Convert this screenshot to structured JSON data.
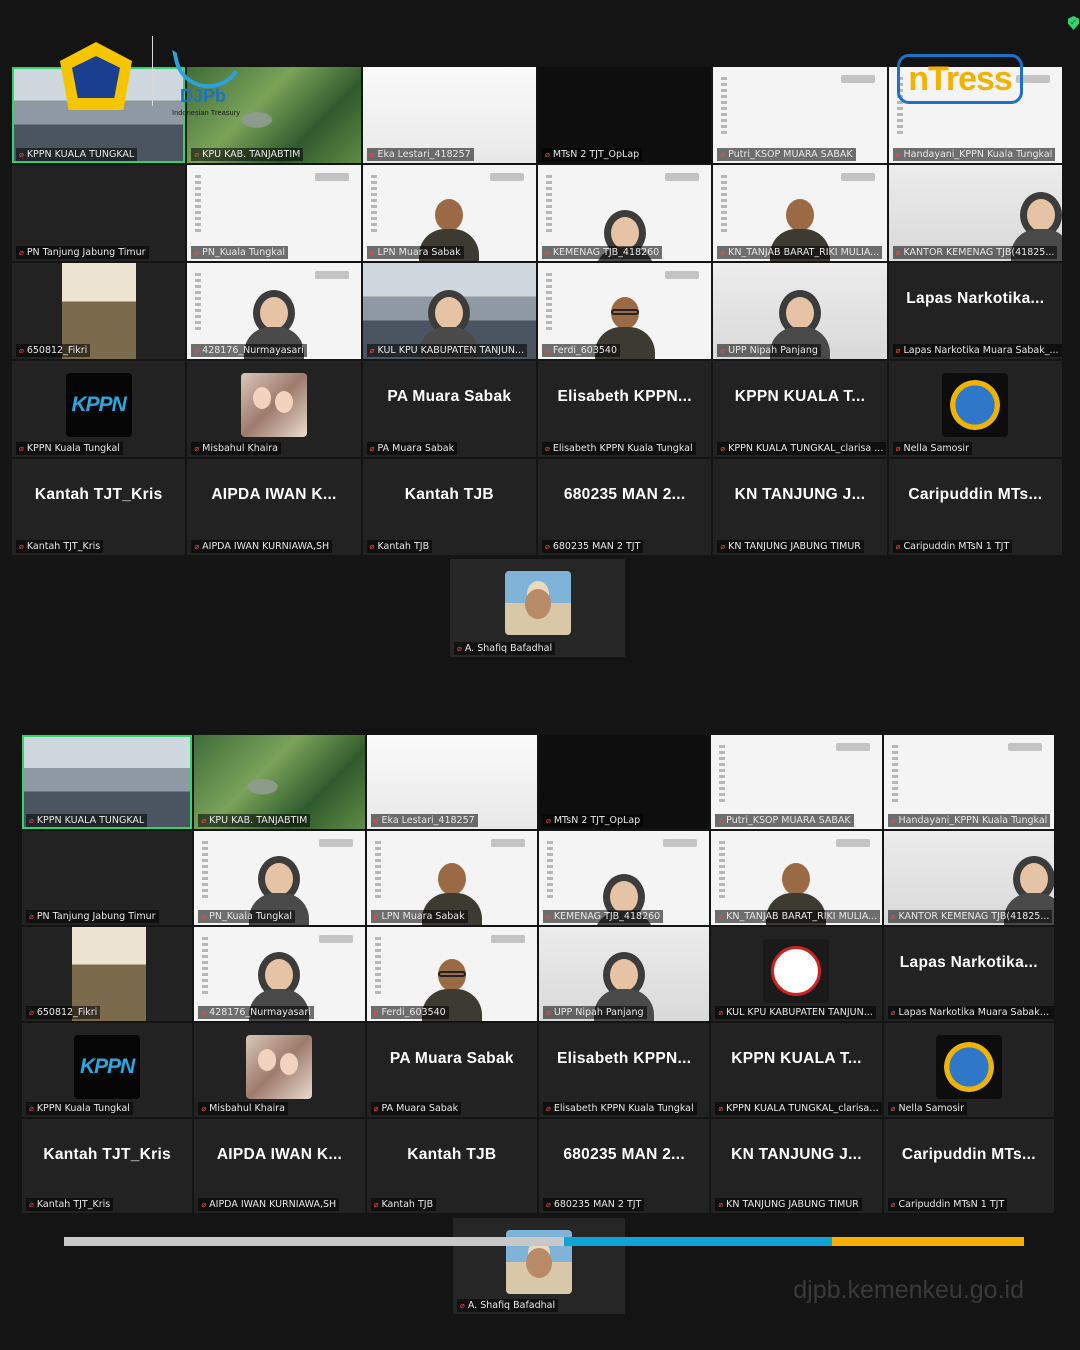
{
  "branding": {
    "djpb_name": "DJPb",
    "djpb_tagline": "Indonesian Treasury",
    "intress_logo": "nTress",
    "website": "djpb.kemenkeu.go.id"
  },
  "colors": {
    "active_speaker": "#2fd46b",
    "muted": "#e54a4a",
    "progress": [
      "#c8c8c8",
      "#0fa4d8",
      "#f6b100"
    ]
  },
  "gallery1": {
    "tiles": [
      {
        "label": "KPPN KUALA TUNGKAL",
        "bg": "room",
        "selected": true,
        "mic": "pin"
      },
      {
        "label": "KPU KAB. TANJABTIM",
        "bg": "forest"
      },
      {
        "label": "Eka Lestari_418257",
        "bg": "blank"
      },
      {
        "label": "MTsN 2 TJT_OpLap",
        "bg": "black"
      },
      {
        "label": "Putri_KSOP MUARA SABAK",
        "bg": "slide"
      },
      {
        "label": "Handayani_KPPN Kuala Tungkal",
        "bg": "slide"
      },
      {
        "label": "PN Tanjung Jabung Timur",
        "bg": "dark"
      },
      {
        "label": "PN_Kuala Tungkal",
        "bg": "slide"
      },
      {
        "label": "LPN Muara Sabak",
        "bg": "slide",
        "person": "man"
      },
      {
        "label": "KEMENAG TJB_418260",
        "bg": "slide",
        "person": "hijab-low"
      },
      {
        "label": "KN_TANJAB BARAT_RIKI MULIA...",
        "bg": "slide",
        "person": "man"
      },
      {
        "label": "KANTOR KEMENAG TJB(41825...",
        "bg": "wall",
        "person": "hijab-side"
      },
      {
        "label": "650812_Fikri",
        "bg": "uniform-small"
      },
      {
        "label": "428176_Nurmayasari",
        "bg": "slide",
        "person": "hijab"
      },
      {
        "label": "KUL KPU KABUPATEN TANJUN...",
        "bg": "room",
        "person": "hijab"
      },
      {
        "label": "Ferdi_603540",
        "bg": "slide",
        "person": "man-glasses"
      },
      {
        "label": "UPP Nipah Panjang",
        "bg": "wall",
        "person": "hijab"
      },
      {
        "label": "Lapas Narkotika Muara Sabak_...",
        "name": "Lapas Narkotika..."
      },
      {
        "label": "KPPN Kuala Tungkal",
        "avatar": "kppn-logo",
        "avatar_text": "KPPN"
      },
      {
        "label": "Misbahul Khaira",
        "avatar": "photo-women"
      },
      {
        "label": "PA Muara Sabak",
        "name": "PA Muara Sabak"
      },
      {
        "label": "Elisabeth KPPN Kuala Tungkal",
        "name": "Elisabeth KPPN..."
      },
      {
        "label": "KPPN KUALA TUNGKAL_clarisa ...",
        "name": "KPPN KUALA T..."
      },
      {
        "label": "Nella Samosir",
        "avatar": "globe-logo"
      },
      {
        "label": "Kantah TJT_Kris",
        "name": "Kantah TJT_Kris"
      },
      {
        "label": "AIPDA IWAN KURNIAWA,SH",
        "name": "AIPDA IWAN K..."
      },
      {
        "label": "Kantah TJB",
        "name": "Kantah TJB"
      },
      {
        "label": "680235 MAN 2 TJT",
        "name": "680235 MAN 2..."
      },
      {
        "label": "KN TANJUNG JABUNG TIMUR",
        "name": "KN TANJUNG J..."
      },
      {
        "label": "Caripuddin MTsN 1 TJT",
        "name": "Caripuddin MTs..."
      }
    ],
    "single": {
      "label": "A. Shafiq Bafadhal",
      "avatar": "photo-man"
    }
  },
  "gallery2": {
    "tiles": [
      {
        "label": "KPPN KUALA TUNGKAL",
        "bg": "room",
        "selected": true
      },
      {
        "label": "KPU KAB. TANJABTIM",
        "bg": "forest"
      },
      {
        "label": "Eka Lestari_418257",
        "bg": "blank"
      },
      {
        "label": "MTsN 2 TJT_OpLap",
        "bg": "black"
      },
      {
        "label": "Putri_KSOP MUARA SABAK",
        "bg": "slide"
      },
      {
        "label": "Handayani_KPPN Kuala Tungkal",
        "bg": "slide"
      },
      {
        "label": "PN Tanjung Jabung Timur",
        "bg": "dark"
      },
      {
        "label": "PN_Kuala Tungkal",
        "bg": "slide",
        "person": "hijab"
      },
      {
        "label": "LPN Muara Sabak",
        "bg": "slide",
        "person": "man"
      },
      {
        "label": "KEMENAG TJB_418260",
        "bg": "slide",
        "person": "hijab-low"
      },
      {
        "label": "KN_TANJAB BARAT_RIKI MULIA...",
        "bg": "slide",
        "person": "man"
      },
      {
        "label": "KANTOR KEMENAG TJB(41825...",
        "bg": "wall",
        "person": "hijab-side"
      },
      {
        "label": "650812_Fikri",
        "bg": "uniform-small"
      },
      {
        "label": "428176_Nurmayasari",
        "bg": "slide",
        "person": "hijab"
      },
      {
        "label": "Ferdi_603540",
        "bg": "slide",
        "person": "man-glasses"
      },
      {
        "label": "UPP Nipah Panjang",
        "bg": "wall",
        "person": "hijab"
      },
      {
        "label": "KUL KPU KABUPATEN TANJUN...",
        "avatar": "komisi-logo"
      },
      {
        "label": "Lapas Narkotika Muara Sabak_...",
        "name": "Lapas Narkotika..."
      },
      {
        "label": "KPPN Kuala Tungkal",
        "avatar": "kppn-logo",
        "avatar_text": "KPPN"
      },
      {
        "label": "Misbahul Khaira",
        "avatar": "photo-women"
      },
      {
        "label": "PA Muara Sabak",
        "name": "PA Muara Sabak"
      },
      {
        "label": "Elisabeth KPPN Kuala Tungkal",
        "name": "Elisabeth KPPN..."
      },
      {
        "label": "KPPN KUALA TUNGKAL_clarisa ...",
        "name": "KPPN KUALA T..."
      },
      {
        "label": "Nella Samosir",
        "avatar": "globe-logo"
      },
      {
        "label": "Kantah TJT_Kris",
        "name": "Kantah TJT_Kris"
      },
      {
        "label": "AIPDA IWAN KURNIAWA,SH",
        "name": "AIPDA IWAN K..."
      },
      {
        "label": "Kantah TJB",
        "name": "Kantah TJB"
      },
      {
        "label": "680235 MAN 2 TJT",
        "name": "680235 MAN 2..."
      },
      {
        "label": "KN TANJUNG JABUNG TIMUR",
        "name": "KN TANJUNG J..."
      },
      {
        "label": "Caripuddin MTsN 1 TJT",
        "name": "Caripuddin MTs..."
      }
    ],
    "single": {
      "label": "A. Shafiq Bafadhal",
      "avatar": "photo-man"
    }
  }
}
